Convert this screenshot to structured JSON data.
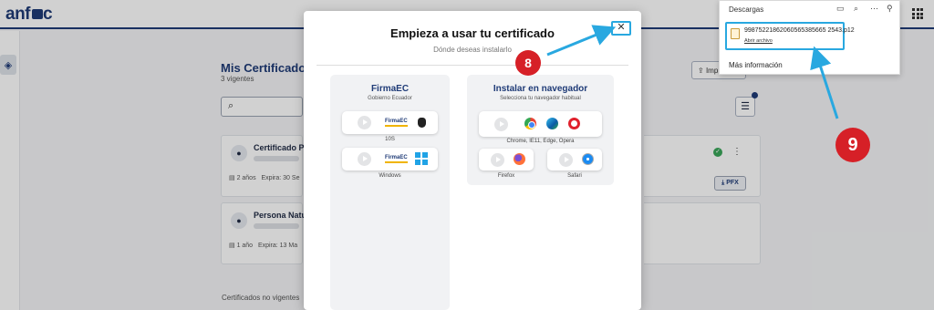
{
  "app": {
    "logo_text": "anf",
    "logo_suffix": "c"
  },
  "background": {
    "page_title": "Mis Certificado",
    "page_subtitle": "3 vigentes",
    "import_label": "Imp",
    "certs": [
      {
        "name": "Certificado Pe",
        "duration": "2 años",
        "expiry": "Expira: 30 Se"
      },
      {
        "name": "Persona Natu",
        "duration": "1 año",
        "expiry": "Expira: 13 Ma"
      }
    ],
    "pfx_label": "PFX",
    "no_vigentes": "Certificados no vigentes"
  },
  "modal": {
    "title": "Empieza a usar tu certificado",
    "subtitle": "Dónde deseas instalarlo",
    "close_glyph": "✕",
    "firmaec": {
      "title": "FirmaEC",
      "subtitle": "Gobierno Ecuador",
      "logo_text": "FirmaEC",
      "options": [
        {
          "caption": "10S"
        },
        {
          "caption": "Windows"
        }
      ]
    },
    "browser": {
      "title": "Instalar en navegador",
      "subtitle": "Selecciona tu navegador habitual",
      "main_caption": "Chrome, IE11, Edge, Opera",
      "firefox_caption": "Firefox",
      "safari_caption": "Safari"
    }
  },
  "downloads": {
    "title": "Descargas",
    "file_name": "99875221862060565385665 2543.p12",
    "open_label": "Abrir archivo",
    "more_info": "Más información"
  },
  "callouts": {
    "step_8": "8",
    "step_9": "9"
  },
  "colors": {
    "brand": "#1f3b77",
    "callout": "#d62027",
    "highlight": "#29a8e0"
  }
}
